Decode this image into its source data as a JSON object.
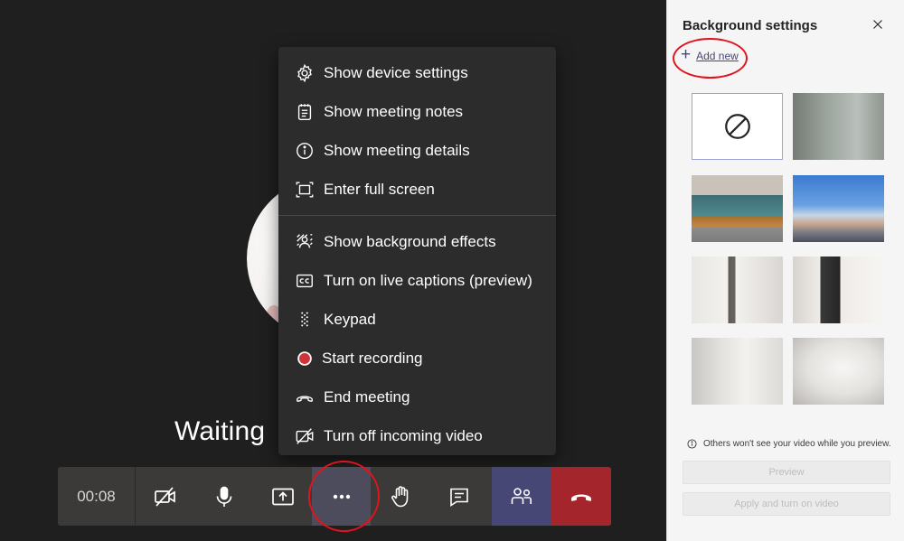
{
  "stage": {
    "waiting_text": "Waiting "
  },
  "menu": {
    "items": [
      {
        "label": "Show device settings",
        "icon": "gear-icon"
      },
      {
        "label": "Show meeting notes",
        "icon": "notes-icon"
      },
      {
        "label": "Show meeting details",
        "icon": "info-icon"
      },
      {
        "label": "Enter full screen",
        "icon": "fullscreen-icon"
      },
      {
        "label": "Show background effects",
        "icon": "background-effects-icon"
      },
      {
        "label": "Turn on live captions (preview)",
        "icon": "captions-icon"
      },
      {
        "label": "Keypad",
        "icon": "keypad-icon"
      },
      {
        "label": "Start recording",
        "icon": "record-icon"
      },
      {
        "label": "End meeting",
        "icon": "end-meeting-icon"
      },
      {
        "label": "Turn off incoming video",
        "icon": "video-off-icon"
      }
    ]
  },
  "toolbar": {
    "timer": "00:08",
    "buttons": [
      "camera-off-icon",
      "microphone-icon",
      "share-screen-icon",
      "more-actions-icon",
      "raise-hand-icon",
      "chat-icon",
      "participants-icon",
      "hang-up-icon"
    ]
  },
  "panel": {
    "title": "Background settings",
    "add_new": "Add new",
    "note": "Others won't see your video while you preview.",
    "preview_label": "Preview",
    "apply_label": "Apply and turn on video"
  },
  "colors": {
    "accent": "#464775",
    "hangup": "#a4262c",
    "record": "#d13438",
    "annotation": "#e0141e"
  }
}
